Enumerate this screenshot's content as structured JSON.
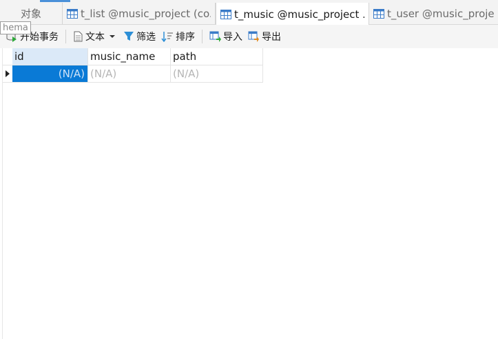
{
  "tabs": {
    "objects": "对象",
    "items": [
      {
        "label": "t_list @music_project (co..."
      },
      {
        "label": "t_music @music_project ..."
      },
      {
        "label": "t_user @music_project"
      }
    ]
  },
  "tooltip": "hema",
  "toolbar": {
    "begin_transaction": "开始事务",
    "text": "文本",
    "filter": "筛选",
    "sort": "排序",
    "import": "导入",
    "export": "导出"
  },
  "grid": {
    "columns": [
      "id",
      "music_name",
      "path"
    ],
    "rows": [
      [
        "(N/A)",
        "(N/A)",
        "(N/A)"
      ]
    ]
  },
  "colors": {
    "selected_cell": "#0a7ad6",
    "header_selected": "#dbe9f8",
    "accent": "#4a90d9"
  }
}
